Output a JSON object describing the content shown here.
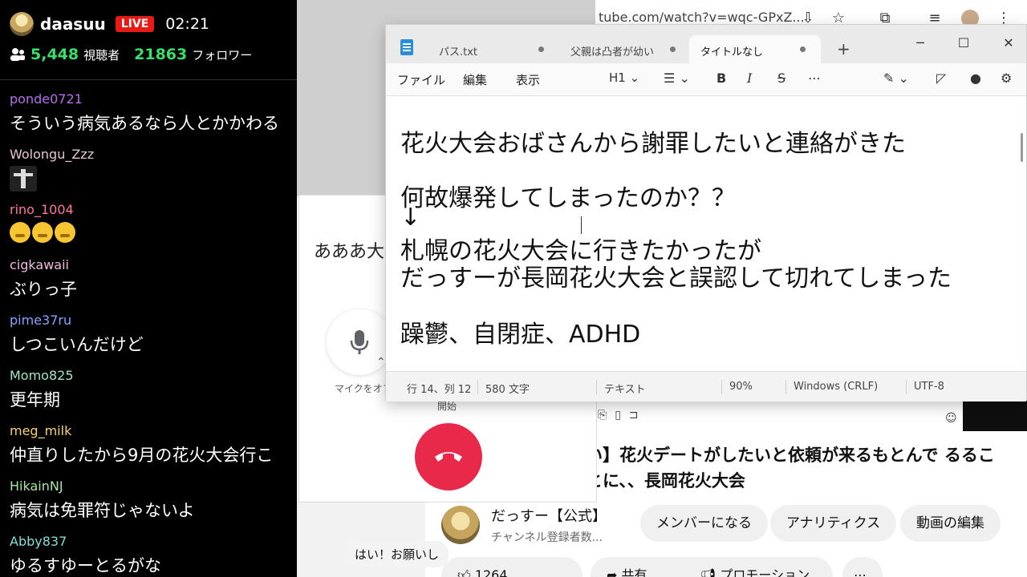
{
  "stream": {
    "streamer": "daasuu",
    "live_label": "LIVE",
    "timer": "02:21",
    "viewers": "5,448",
    "viewers_label": "視聴者",
    "followers": "21863",
    "followers_label": "フォロワー"
  },
  "chat": [
    {
      "user": "ponde0721",
      "color": "#b96cf1",
      "text": "そういう病気あるなら人とかかわる"
    },
    {
      "user": "Wolongu_Zzz",
      "color": "#e7c3d2",
      "emote": "figure-emote"
    },
    {
      "user": "rino_1004",
      "color": "#ff7a9a",
      "emoji": [
        "lying-face-emoji",
        "lying-face-emoji",
        "lying-face-emoji"
      ]
    },
    {
      "user": "cigkawaii",
      "color": "#f3b8e0",
      "text": "ぶりっ子"
    },
    {
      "user": "pime37ru",
      "color": "#8aa2ff",
      "text": "しつこいんだけど"
    },
    {
      "user": "Momo825",
      "color": "#9ee6c6",
      "text": "更年期"
    },
    {
      "user": "meg_milk",
      "color": "#f7d36a",
      "text": "仲直りしたから9月の花火大会行こ"
    },
    {
      "user": "HikainNJ",
      "color": "#a6e7a0",
      "text": "病気は免罪符じゃないよ"
    },
    {
      "user": "Abby837",
      "color": "#7ee0d9",
      "text": "ゆるすゆーとるがな"
    }
  ],
  "browser": {
    "url": "tube.com/watch?v=wqc-GPxZ..."
  },
  "youtube": {
    "title": "い】花火デートがしたいと依頼が来るもとんで るることに、、長岡花火大会",
    "channel_name": "だっすー【公式】",
    "channel_subs": "チャンネル登録者数...",
    "member_button": "メンバーになる",
    "analytics_button": "アナリティクス",
    "edit_button": "動画の編集",
    "like_count": "1264",
    "share_label": "共有",
    "promo_label": "プロモーション",
    "comment_text": "はい！お願いし"
  },
  "call": {
    "title": "あああ大",
    "mic_label": "マイクをオフ",
    "start_label": "開始"
  },
  "notepad": {
    "tabs": [
      {
        "label": "パス.txt"
      },
      {
        "label": "父親は凸者が幼い"
      },
      {
        "label": "タイトルなし"
      }
    ],
    "menus": {
      "file": "ファイル",
      "edit": "編集",
      "view": "表示"
    },
    "heading": "H1",
    "lines": [
      "花火大会おばさんから謝罪したいと連絡がきた",
      "何故爆発してしまったのか？？",
      "↓",
      "札幌の花火大会に行きたかったが",
      "だっすーが長岡花火大会と誤認して切れてしまった",
      "躁鬱、自閉症、ADHD"
    ],
    "status": {
      "position": "行 14、列 12",
      "chars": "580 文字",
      "format": "テキスト",
      "zoom": "90%",
      "eol": "Windows (CRLF)",
      "encoding": "UTF-8"
    }
  }
}
